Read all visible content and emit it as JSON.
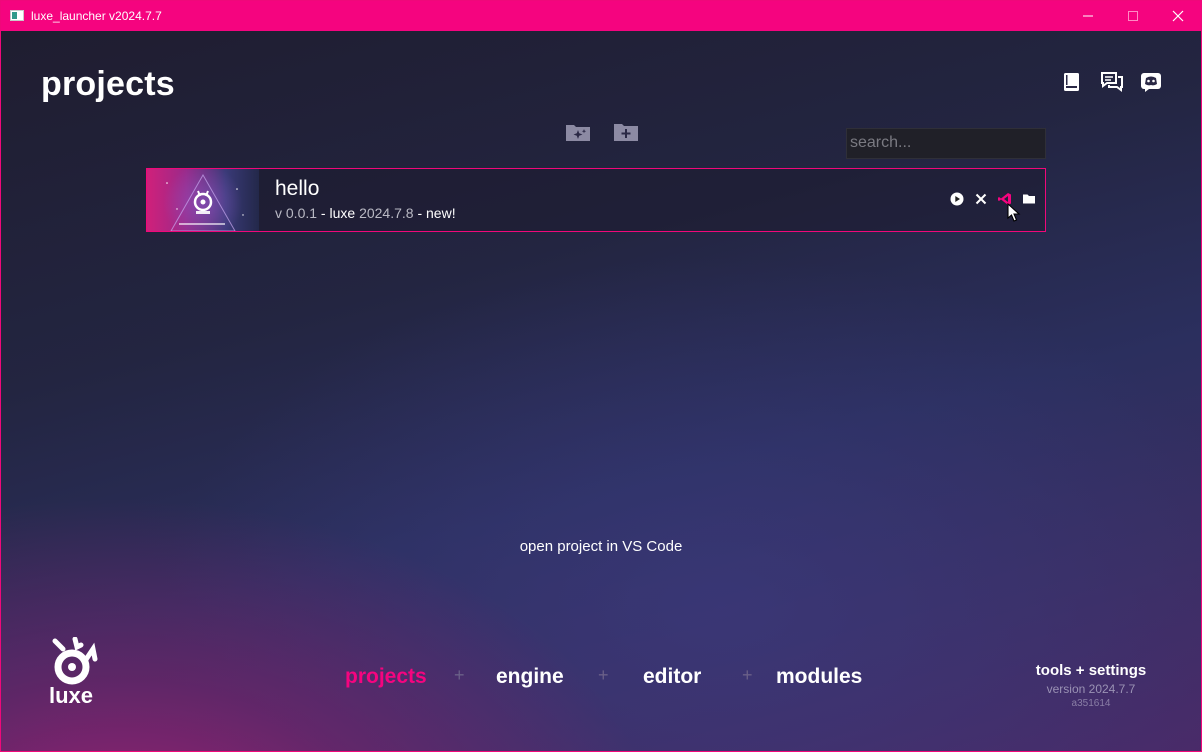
{
  "window": {
    "title": "luxe_launcher v2024.7.7",
    "controls": [
      "minimize",
      "maximize",
      "close"
    ]
  },
  "header": {
    "title": "projects",
    "icons": [
      "book-icon",
      "feedback-icon",
      "discord-icon"
    ]
  },
  "toolbar": {
    "icons": [
      "new-project-template-icon",
      "add-project-folder-icon"
    ]
  },
  "search": {
    "placeholder": "search..."
  },
  "projects": [
    {
      "name": "hello",
      "version_prefix": "v",
      "version": "0.0.1",
      "engine_label": "luxe",
      "engine_version": "2024.7.8",
      "status": "new!",
      "actions": [
        "play-icon",
        "remove-icon",
        "vscode-icon",
        "folder-icon"
      ]
    }
  ],
  "tooltip": "open project in VS Code",
  "brand": {
    "name": "luxe"
  },
  "nav": {
    "items": [
      "projects",
      "engine",
      "editor",
      "modules"
    ],
    "active": "projects",
    "separator": "+"
  },
  "footer": {
    "tools_label": "tools + settings",
    "version_label": "version 2024.7.7",
    "build_hash": "a351614"
  },
  "colors": {
    "accent": "#f5047f",
    "title_bar": "#f5047f"
  }
}
